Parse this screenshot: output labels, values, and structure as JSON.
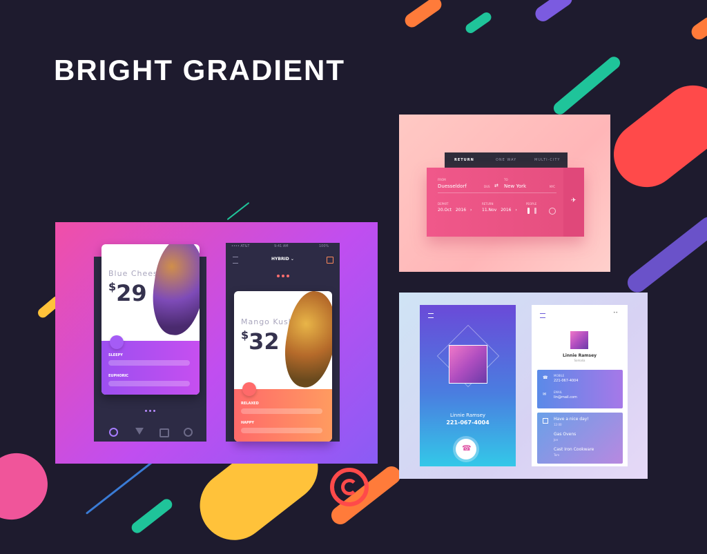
{
  "title": "BRIGHT GRADIENT",
  "phone1": {
    "product": "Blue Cheese",
    "price_symbol": "$",
    "price": "29",
    "bars": [
      "SLEEPY",
      "EUPHORIC"
    ]
  },
  "phone2": {
    "status_left": "•••• AT&T",
    "status_time": "9:41 AM",
    "status_right": "100%",
    "menu": "HYBRID ⌄",
    "product": "Mango Kush",
    "price_symbol": "$",
    "price": "32",
    "bars": [
      "RELAXED",
      "HAPPY"
    ]
  },
  "flight": {
    "tabs": [
      "RETURN",
      "ONE WAY",
      "MULTI-CITY"
    ],
    "from_label": "FROM",
    "from_city": "Duesseldorf",
    "from_code": "DUS",
    "to_label": "TO",
    "to_city": "New York",
    "to_code": "NYC",
    "depart_label": "DEPART",
    "depart_day": "20.Oct",
    "depart_year": "2016",
    "return_label": "RETURN",
    "return_day": "11.Nov",
    "return_year": "2016",
    "people_label": "PEOPLE"
  },
  "contact": {
    "left_name": "Linnie Ramsey",
    "left_phone": "221-067-4004",
    "right_name": "Linnie Ramsey",
    "right_subtitle": "Somalia",
    "mobile_label": "MOBILE",
    "mobile_value": "221-067-4004",
    "email_label": "EMAIL",
    "email_value": "lin@mail.com",
    "msg1": "Have a nice day!",
    "msg1_sub": "12:00",
    "msg2": "Gas Ovens",
    "msg2_sub": "Jon",
    "msg3": "Cast Iron Cookware",
    "msg3_sub": "Tom"
  },
  "colors": {
    "background": "#1e1b2e",
    "pink": "#f04fa8",
    "purple": "#8a5cf5",
    "orange": "#ff7b3a",
    "teal": "#1fc49a",
    "red": "#ff4a4a",
    "yellow": "#ffc23a"
  }
}
